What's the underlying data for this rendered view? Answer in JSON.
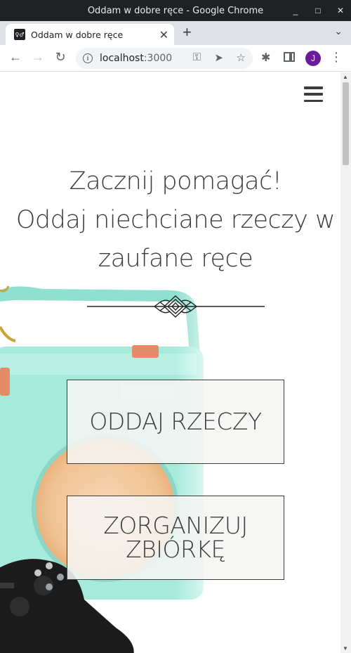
{
  "window": {
    "title": "Oddam w dobre ręce - Google Chrome",
    "controls": {
      "minimize": "_",
      "maximize": "□",
      "close": "✕"
    }
  },
  "tab": {
    "favicon_text": "♀♂",
    "title": "Oddam w dobre ręce",
    "close": "✕",
    "new_tab": "+",
    "menu": "⌄"
  },
  "toolbar": {
    "back": "←",
    "forward": "→",
    "reload": "↻",
    "url_host": "localhost",
    "url_port": ":3000",
    "info_icon": "i",
    "key": "⚿",
    "send": "➤",
    "star": "☆",
    "extensions": "✱",
    "avatar_initial": "J",
    "menu": "⋮"
  },
  "page": {
    "heading_lines": [
      "Zacznij pomagać!",
      "Oddaj niechciane rzeczy w",
      "zaufane ręce"
    ],
    "buttons": {
      "give": "ODDAJ RZECZY",
      "collect_line1": "ZORGANIZUJ",
      "collect_line2": "ZBIÓRKĘ"
    }
  },
  "colors": {
    "text": "#3c3c3c",
    "chrome_dark": "#202124",
    "tabstrip": "#dee1e6",
    "avatar": "#6a1b9a",
    "radio_teal": "#9ee6d8",
    "speaker": "#f3c89e"
  }
}
